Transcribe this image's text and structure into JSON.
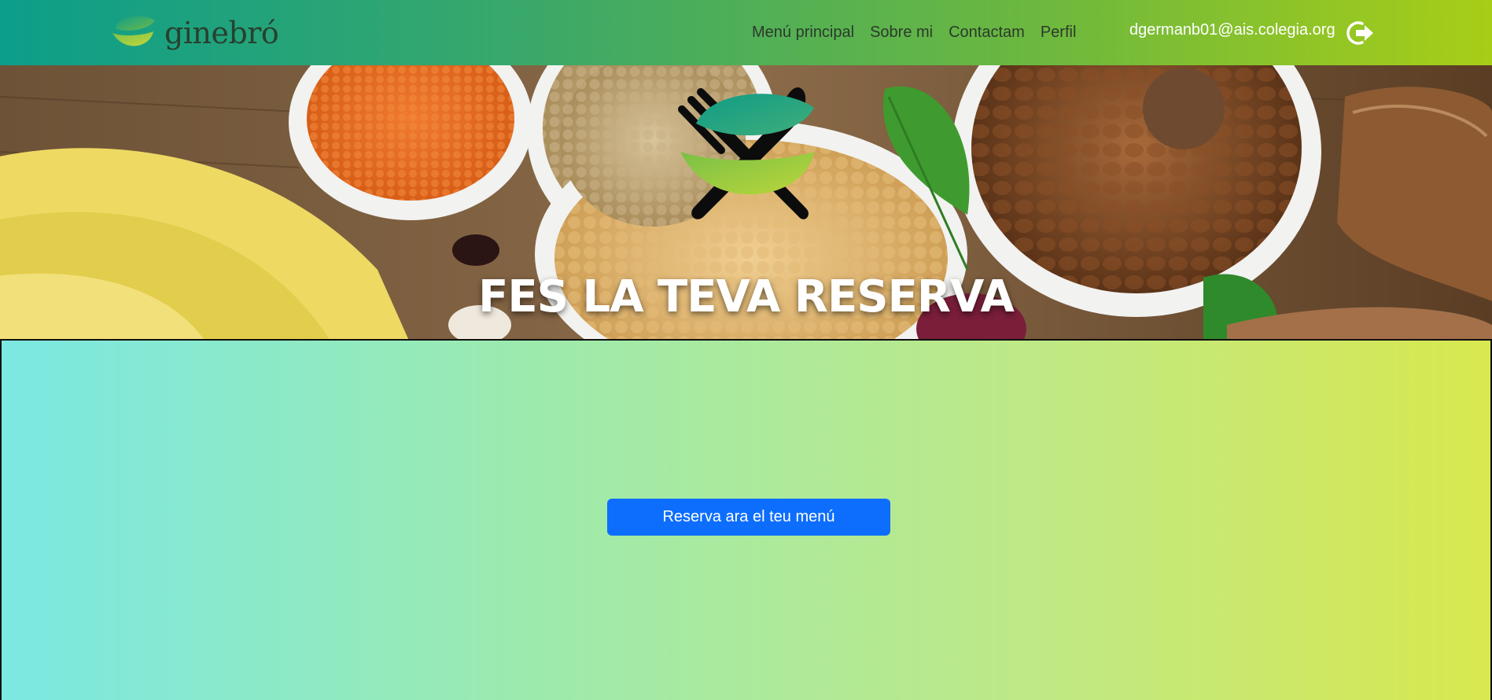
{
  "header": {
    "brand_name": "ginebró",
    "nav": [
      {
        "label": "Menú principal"
      },
      {
        "label": "Sobre mi"
      },
      {
        "label": "Contactam"
      },
      {
        "label": "Perfil"
      }
    ],
    "user_email": "dgermanb01@ais.colegia.org",
    "logout_icon": "logout-icon"
  },
  "hero": {
    "title": "FES LA TEVA RESERVA",
    "logo_icon": "fork-knife-leaf-logo"
  },
  "main": {
    "cta_label": "Reserva ara el teu menú"
  },
  "colors": {
    "cta": "#0d6efd",
    "nav_gradient_start": "#0c9e8a",
    "nav_gradient_end": "#a8cd17",
    "main_gradient_start": "#7be8e2",
    "main_gradient_end": "#d8e84e"
  }
}
